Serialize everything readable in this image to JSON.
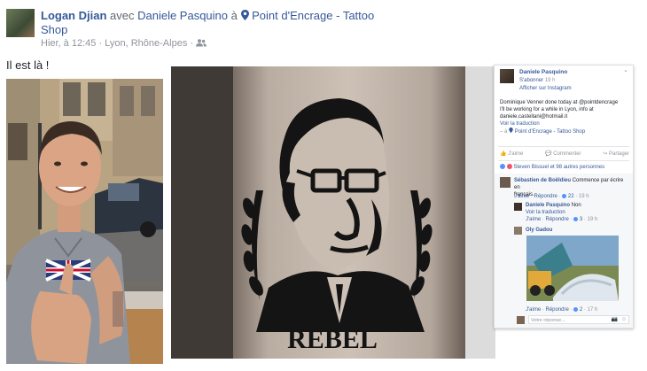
{
  "post": {
    "author": "Logan Djian",
    "with_text": "avec",
    "tagged": "Daniele Pasquino",
    "at_text": "à",
    "place_part1": "Point d'Encrage - Tattoo",
    "place_part2": "Shop",
    "time": "Hier, à 12:45",
    "location": "Lyon, Rhône-Alpes",
    "separator": "·",
    "caption": "Il est là !"
  },
  "tattoo": {
    "text": "REBEL"
  },
  "panel": {
    "author": "Daniele Pasquino",
    "follow": "S'abonner",
    "time": "19 h",
    "instagram": "Afficher sur Instagram",
    "body_line1": "Dominique Venner done today at @pointdencrage",
    "body_line2": "I'll be working for a while in Lyon, info at",
    "body_line3": "daniele.castellani@hotmail.it",
    "translate": "Voir la traduction",
    "at_prefix": "– à",
    "place": "Point d'Encrage - Tattoo Shop",
    "actions": {
      "like": "J'aime",
      "comment": "Commenter",
      "share": "Partager"
    },
    "reactions": "Steven Bissuel et 98 autres personnes",
    "comments": [
      {
        "author": "Sébastien de Boëldieu",
        "text_line1": "Commence par écrire en",
        "text_line2": "français.",
        "like": "J'aime",
        "reply": "Répondre",
        "count": "22",
        "time": "19 h"
      },
      {
        "author": "Daniele Pasquino",
        "text": "Non",
        "translate": "Voir la traduction",
        "like": "J'aime",
        "reply": "Répondre",
        "count": "3",
        "time": "19 h"
      },
      {
        "author": "Oly Gadou",
        "like": "J'aime",
        "reply": "Répondre",
        "count": "2",
        "time": "17 h"
      }
    ],
    "reply_placeholder": "Votre réponse..."
  },
  "colors": {
    "link": "#365899",
    "muted": "#90949c",
    "reaction_blue": "#5890ff",
    "love_red": "#f25268"
  }
}
